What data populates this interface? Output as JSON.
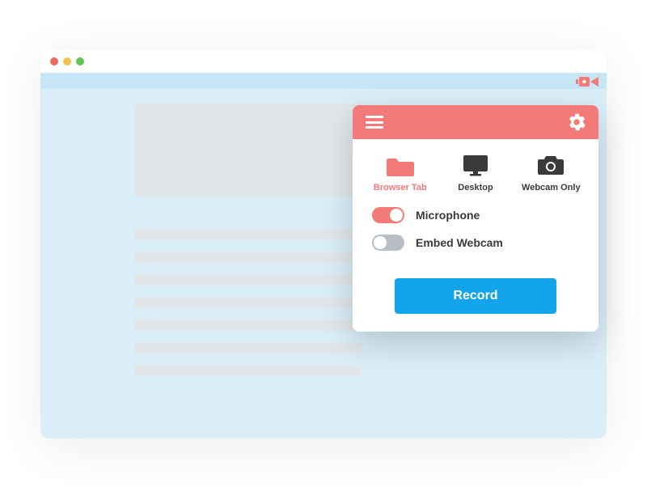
{
  "colors": {
    "accent": "#f37a78",
    "primary": "#14a4eb",
    "page_bg": "#daeef8",
    "skeleton": "#e0e6ea"
  },
  "extension": {
    "modes": [
      {
        "id": "browser_tab",
        "label": "Browser Tab",
        "icon": "folder-icon",
        "active": true
      },
      {
        "id": "desktop",
        "label": "Desktop",
        "icon": "monitor-icon",
        "active": false
      },
      {
        "id": "webcam_only",
        "label": "Webcam Only",
        "icon": "camera-icon",
        "active": false
      }
    ],
    "toggles": {
      "microphone": {
        "label": "Microphone",
        "on": true
      },
      "embed_webcam": {
        "label": "Embed Webcam",
        "on": false
      }
    },
    "record_label": "Record"
  }
}
